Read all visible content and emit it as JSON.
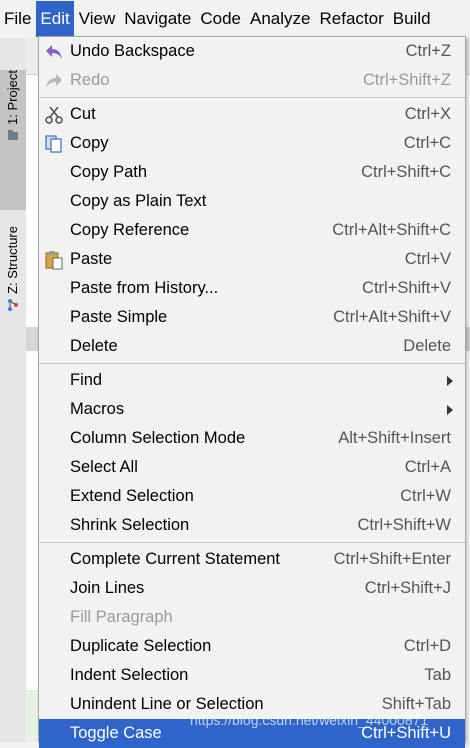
{
  "menubar": {
    "items": [
      {
        "label": "File"
      },
      {
        "label": "Edit"
      },
      {
        "label": "View"
      },
      {
        "label": "Navigate"
      },
      {
        "label": "Code"
      },
      {
        "label": "Analyze"
      },
      {
        "label": "Refactor"
      },
      {
        "label": "Build"
      }
    ],
    "active_index": 1,
    "active_color": "#2f65ca"
  },
  "toolwindows": {
    "project_label": "1: Project",
    "structure_label": "Z: Structure"
  },
  "edit_menu": {
    "groups": [
      [
        {
          "label": "Undo Backspace",
          "shortcut": "Ctrl+Z",
          "icon": "undo-icon"
        },
        {
          "label": "Redo",
          "shortcut": "Ctrl+Shift+Z",
          "icon": "redo-icon",
          "disabled": true
        }
      ],
      [
        {
          "label": "Cut",
          "shortcut": "Ctrl+X",
          "icon": "scissors-icon"
        },
        {
          "label": "Copy",
          "shortcut": "Ctrl+C",
          "icon": "copy-icon"
        },
        {
          "label": "Copy Path",
          "shortcut": "Ctrl+Shift+C"
        },
        {
          "label": "Copy as Plain Text",
          "shortcut": ""
        },
        {
          "label": "Copy Reference",
          "shortcut": "Ctrl+Alt+Shift+C"
        },
        {
          "label": "Paste",
          "shortcut": "Ctrl+V",
          "icon": "clipboard-icon"
        },
        {
          "label": "Paste from History...",
          "shortcut": "Ctrl+Shift+V"
        },
        {
          "label": "Paste Simple",
          "shortcut": "Ctrl+Alt+Shift+V"
        },
        {
          "label": "Delete",
          "shortcut": "Delete"
        }
      ],
      [
        {
          "label": "Find",
          "shortcut": "",
          "submenu": true
        },
        {
          "label": "Macros",
          "shortcut": "",
          "submenu": true
        },
        {
          "label": "Column Selection Mode",
          "shortcut": "Alt+Shift+Insert"
        },
        {
          "label": "Select All",
          "shortcut": "Ctrl+A"
        },
        {
          "label": "Extend Selection",
          "shortcut": "Ctrl+W"
        },
        {
          "label": "Shrink Selection",
          "shortcut": "Ctrl+Shift+W"
        }
      ],
      [
        {
          "label": "Complete Current Statement",
          "shortcut": "Ctrl+Shift+Enter"
        },
        {
          "label": "Join Lines",
          "shortcut": "Ctrl+Shift+J"
        },
        {
          "label": "Fill Paragraph",
          "shortcut": "",
          "disabled": true
        },
        {
          "label": "Duplicate Selection",
          "shortcut": "Ctrl+D"
        },
        {
          "label": "Indent Selection",
          "shortcut": "Tab"
        },
        {
          "label": "Unindent Line or Selection",
          "shortcut": "Shift+Tab"
        },
        {
          "label": "Toggle Case",
          "shortcut": "Ctrl+Shift+U",
          "selected": true
        }
      ]
    ]
  },
  "watermark": "https://blog.csdn.net/weixin_44000871"
}
